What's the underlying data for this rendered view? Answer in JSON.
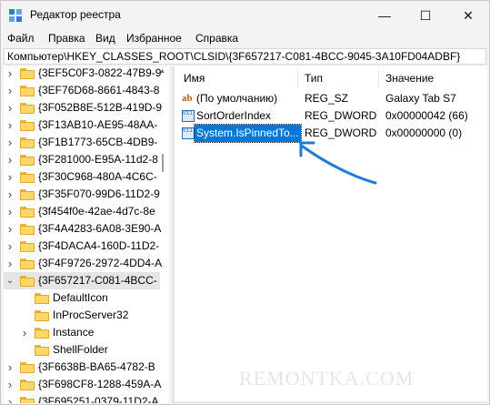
{
  "window": {
    "title": "Редактор реестра",
    "minimize": "—",
    "maximize": "☐",
    "close": "✕"
  },
  "menu": {
    "items": [
      "Файл",
      "Правка",
      "Вид",
      "Избранное",
      "Справка"
    ]
  },
  "address": {
    "path": "Компьютер\\HKEY_CLASSES_ROOT\\CLSID\\{3F657217-C081-4BCC-9045-3A10FD04ADBF}"
  },
  "tree": {
    "items": [
      {
        "label": "{3EF5C0F3-0822-47B9-9",
        "level": 0
      },
      {
        "label": "{3EF76D68-8661-4843-8",
        "level": 0
      },
      {
        "label": "{3F052B8E-512B-419D-9",
        "level": 0
      },
      {
        "label": "{3F13AB10-AE95-48AA-",
        "level": 0
      },
      {
        "label": "{3F1B1773-65CB-4DB9-",
        "level": 0
      },
      {
        "label": "{3F281000-E95A-11d2-8",
        "level": 0
      },
      {
        "label": "{3F30C968-480A-4C6C-",
        "level": 0
      },
      {
        "label": "{3F35F070-99D6-11D2-9",
        "level": 0
      },
      {
        "label": "{3f454f0e-42ae-4d7c-8e",
        "level": 0
      },
      {
        "label": "{3F4A4283-6A08-3E90-A",
        "level": 0
      },
      {
        "label": "{3F4DACA4-160D-11D2-",
        "level": 0
      },
      {
        "label": "{3F4F9726-2972-4DD4-A",
        "level": 0
      },
      {
        "label": "{3F657217-C081-4BCC-",
        "level": 0,
        "expanded": true,
        "selected": true
      },
      {
        "label": "DefaultIcon",
        "level": 1
      },
      {
        "label": "InProcServer32",
        "level": 1
      },
      {
        "label": "Instance",
        "level": 1,
        "has_children": true
      },
      {
        "label": "ShellFolder",
        "level": 1
      },
      {
        "label": "{3F6638B-BA65-4782-B",
        "level": 0
      },
      {
        "label": "{3F698CF8-1288-459A-A",
        "level": 0
      },
      {
        "label": "{3F695251-0379-11D2-A",
        "level": 0
      }
    ]
  },
  "list": {
    "columns": [
      "Имя",
      "Тип",
      "Значение"
    ],
    "rows": [
      {
        "icon": "ab",
        "name": "(По умолчанию)",
        "type": "REG_SZ",
        "value": "Galaxy Tab S7"
      },
      {
        "icon": "bin",
        "name": "SortOrderIndex",
        "type": "REG_DWORD",
        "value": "0x00000042 (66)"
      },
      {
        "icon": "bin",
        "name": "System.IsPinnedTo...",
        "type": "REG_DWORD",
        "value": "0x00000000 (0)",
        "selected": true
      }
    ]
  },
  "annotation": {
    "arrow_color": "#1f7bd6"
  },
  "watermark": {
    "text": "REMONTKA.COM"
  },
  "colors": {
    "accent": "#0078d7",
    "folder": "#ffd766"
  }
}
